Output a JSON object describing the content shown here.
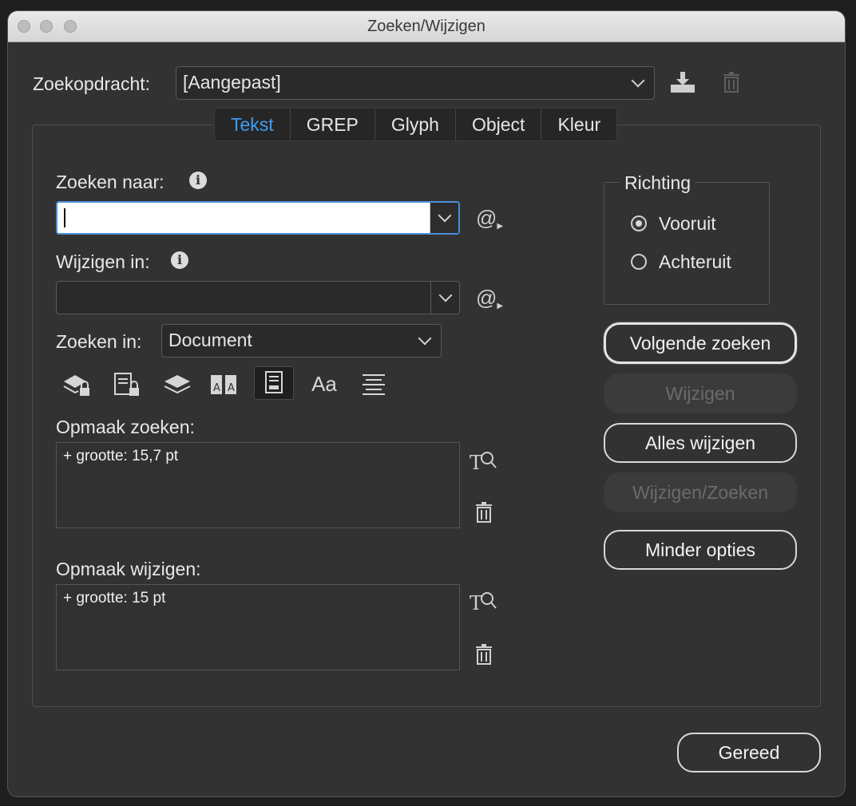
{
  "window": {
    "title": "Zoeken/Wijzigen"
  },
  "query": {
    "label": "Zoekopdracht:",
    "value": "[Aangepast]"
  },
  "tabs": [
    {
      "label": "Tekst",
      "active": true
    },
    {
      "label": "GREP",
      "active": false
    },
    {
      "label": "Glyph",
      "active": false
    },
    {
      "label": "Object",
      "active": false
    },
    {
      "label": "Kleur",
      "active": false
    }
  ],
  "find": {
    "label": "Zoeken naar:",
    "value": ""
  },
  "change": {
    "label": "Wijzigen in:",
    "value": ""
  },
  "scope": {
    "label": "Zoeken in:",
    "value": "Document"
  },
  "special_char": "@",
  "format_find": {
    "label": "Opmaak zoeken:",
    "value": "+ grootte: 15,7 pt"
  },
  "format_change": {
    "label": "Opmaak wijzigen:",
    "value": "+ grootte: 15 pt"
  },
  "direction": {
    "label": "Richting",
    "forward": "Vooruit",
    "backward": "Achteruit",
    "selected": "forward"
  },
  "buttons": {
    "find_next": "Volgende zoeken",
    "change": "Wijzigen",
    "change_all": "Alles wijzigen",
    "change_find": "Wijzigen/Zoeken",
    "fewer_options": "Minder opties",
    "done": "Gereed"
  },
  "tool_icons": [
    "locked-layers-icon",
    "locked-stories-icon",
    "hidden-layers-icon",
    "master-pages-icon",
    "footnotes-icon",
    "case-sensitive-icon",
    "whole-word-icon"
  ],
  "case_glyph": "Aa",
  "colors": {
    "accent": "#3f9cf0",
    "panel_bg": "#323232",
    "focus": "#4a90d9"
  }
}
